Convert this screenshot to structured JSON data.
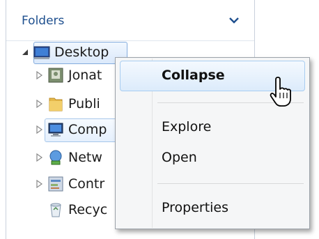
{
  "folders_panel": {
    "title": "Folders",
    "tree": [
      {
        "label": "Desktop",
        "icon": "desktop-icon",
        "expanded": true
      },
      {
        "label": "Jonat",
        "icon": "user-folder-icon"
      },
      {
        "label": "Publi",
        "icon": "folder-icon"
      },
      {
        "label": "Comp",
        "icon": "computer-icon"
      },
      {
        "label": "Netw",
        "icon": "network-icon"
      },
      {
        "label": "Contr",
        "icon": "control-panel-icon"
      },
      {
        "label": "Recyc",
        "icon": "recycle-bin-icon"
      }
    ]
  },
  "context_menu": {
    "items": [
      {
        "label": "Collapse",
        "bold": true,
        "highlighted": true
      },
      {
        "label": "Explore"
      },
      {
        "label": "Open"
      },
      {
        "label": "Properties"
      }
    ]
  },
  "colors": {
    "header_text": "#1e4f8e",
    "selection_border": "#84acdd",
    "menu_bg": "#f5f6f7"
  }
}
